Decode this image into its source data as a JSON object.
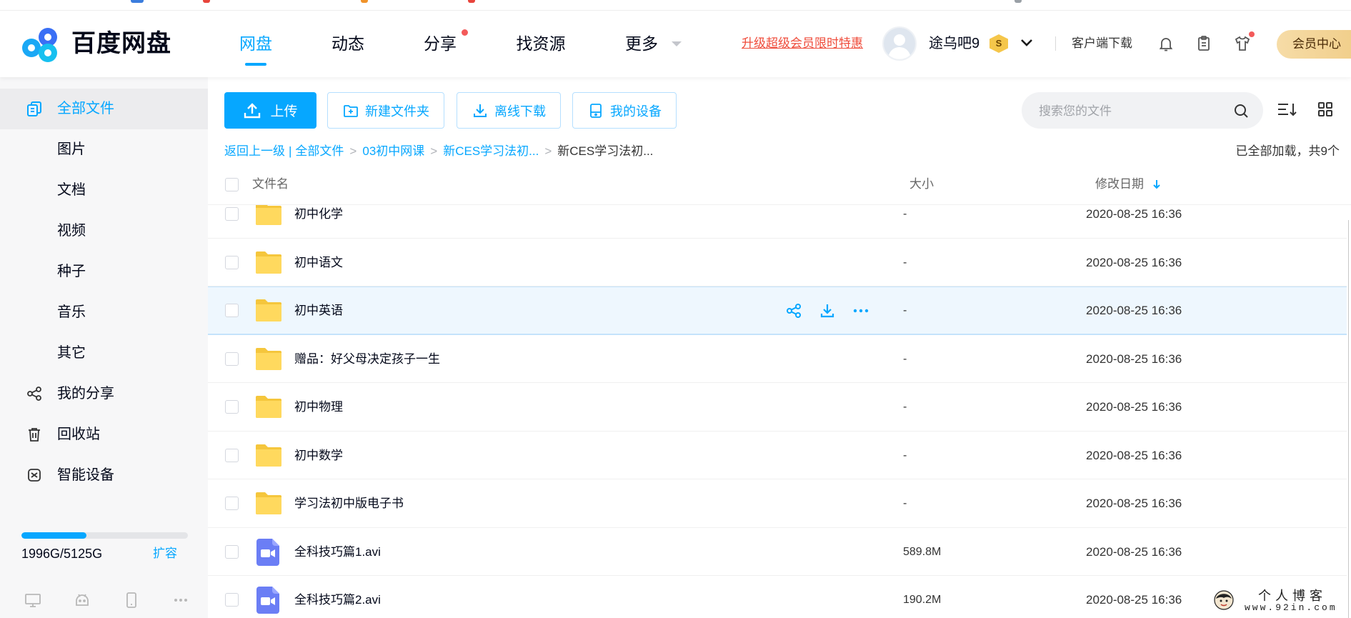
{
  "app": {
    "logo_text": "百度网盘",
    "logo_icon": "baidu-netdisk-logo-icon"
  },
  "nav": {
    "items": [
      {
        "label": "网盘",
        "active": true
      },
      {
        "label": "动态"
      },
      {
        "label": "分享",
        "notification_dot": true
      },
      {
        "label": "找资源"
      },
      {
        "label": "更多",
        "dropdown": true
      }
    ]
  },
  "header": {
    "promo": "升级超级会员限时特惠",
    "username": "途乌吧9",
    "badge": "S",
    "client_download": "客户端下载",
    "icons": [
      "bell-icon",
      "clipboard-icon",
      "shirt-icon"
    ],
    "vip_center": "会员中心"
  },
  "sidebar": {
    "items": [
      {
        "label": "全部文件",
        "icon": "files-icon",
        "active": true
      },
      {
        "label": "图片"
      },
      {
        "label": "文档"
      },
      {
        "label": "视频"
      },
      {
        "label": "种子"
      },
      {
        "label": "音乐"
      },
      {
        "label": "其它"
      },
      {
        "label": "我的分享",
        "icon": "share-icon"
      },
      {
        "label": "回收站",
        "icon": "trash-icon"
      },
      {
        "label": "智能设备",
        "icon": "smart-device-icon"
      }
    ],
    "storage": {
      "text": "1996G/5125G",
      "used_fraction": 0.39,
      "expand": "扩容"
    },
    "bottom_icons": [
      "desktop-icon",
      "android-icon",
      "phone-icon",
      "more-dots-icon"
    ]
  },
  "toolbar": {
    "upload": "上传",
    "new_folder": "新建文件夹",
    "offline_download": "离线下载",
    "my_devices": "我的设备"
  },
  "search": {
    "placeholder": "搜索您的文件"
  },
  "view_icons": [
    "sort-icon",
    "grid-view-icon"
  ],
  "breadcrumb": {
    "back": "返回上一级",
    "bar": "|",
    "separator": ">",
    "items": [
      "全部文件",
      "03初中网课",
      "新CES学习法初...",
      "新CES学习法初..."
    ]
  },
  "status": "已全部加载，共9个",
  "table": {
    "headers": {
      "name": "文件名",
      "size": "大小",
      "date": "修改日期",
      "sorted_by": "date",
      "sort_direction": "desc"
    },
    "row_actions": [
      "share-icon",
      "download-icon",
      "more-icon"
    ],
    "rows": [
      {
        "type": "folder",
        "name": "初中化学",
        "size": "-",
        "date": "2020-08-25 16:36"
      },
      {
        "type": "folder",
        "name": "初中语文",
        "size": "-",
        "date": "2020-08-25 16:36"
      },
      {
        "type": "folder",
        "name": "初中英语",
        "size": "-",
        "date": "2020-08-25 16:36",
        "hovered": true
      },
      {
        "type": "folder",
        "name": "赠品：好父母决定孩子一生",
        "size": "-",
        "date": "2020-08-25 16:36"
      },
      {
        "type": "folder",
        "name": "初中物理",
        "size": "-",
        "date": "2020-08-25 16:36"
      },
      {
        "type": "folder",
        "name": "初中数学",
        "size": "-",
        "date": "2020-08-25 16:36"
      },
      {
        "type": "folder",
        "name": "学习法初中版电子书",
        "size": "-",
        "date": "2020-08-25 16:36"
      },
      {
        "type": "video",
        "name": "全科技巧篇1.avi",
        "size": "589.8M",
        "date": "2020-08-25 16:36"
      },
      {
        "type": "video",
        "name": "全科技巧篇2.avi",
        "size": "190.2M",
        "date": "2020-08-25 16:36"
      }
    ]
  },
  "watermark": {
    "title": "个人博客",
    "url": "www.92in.com"
  },
  "colors": {
    "accent": "#06a7ff",
    "promo": "#ef4c3b",
    "notification_dot": "#f35a5a",
    "folder": "#ffd04b",
    "video": "#6b7ef5",
    "vip_button": "#f4d595",
    "hover_row": "#eef7fe"
  }
}
